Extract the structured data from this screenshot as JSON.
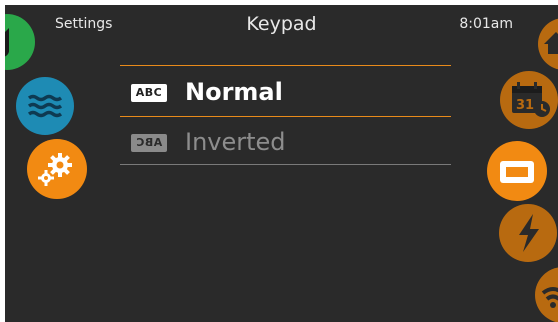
{
  "header": {
    "left": "Settings",
    "title": "Keypad",
    "time": "8:01am"
  },
  "options": [
    {
      "badge": "ABC",
      "label": "Normal",
      "selected": true
    },
    {
      "badge": "ABC",
      "label": "Inverted",
      "selected": false
    }
  ],
  "left_icons": [
    {
      "name": "music-icon",
      "color": "#2aa84a"
    },
    {
      "name": "water-icon",
      "color": "#1e8bb4"
    },
    {
      "name": "gears-icon",
      "color": "#f28a12"
    }
  ],
  "right_icons": [
    {
      "name": "home-icon",
      "color": "#b86a10"
    },
    {
      "name": "calendar-icon",
      "color": "#b86a10",
      "text": "31"
    },
    {
      "name": "keypad-icon",
      "color": "#f28a12"
    },
    {
      "name": "lightning-icon",
      "color": "#b86a10"
    },
    {
      "name": "wifi-icon",
      "color": "#b86a10"
    }
  ],
  "colors": {
    "background": "#2a2a2a",
    "accent": "#f28a12",
    "accent_dim": "#b86a10",
    "divider_active": "#e88a1a",
    "divider": "#7a7a7a"
  }
}
